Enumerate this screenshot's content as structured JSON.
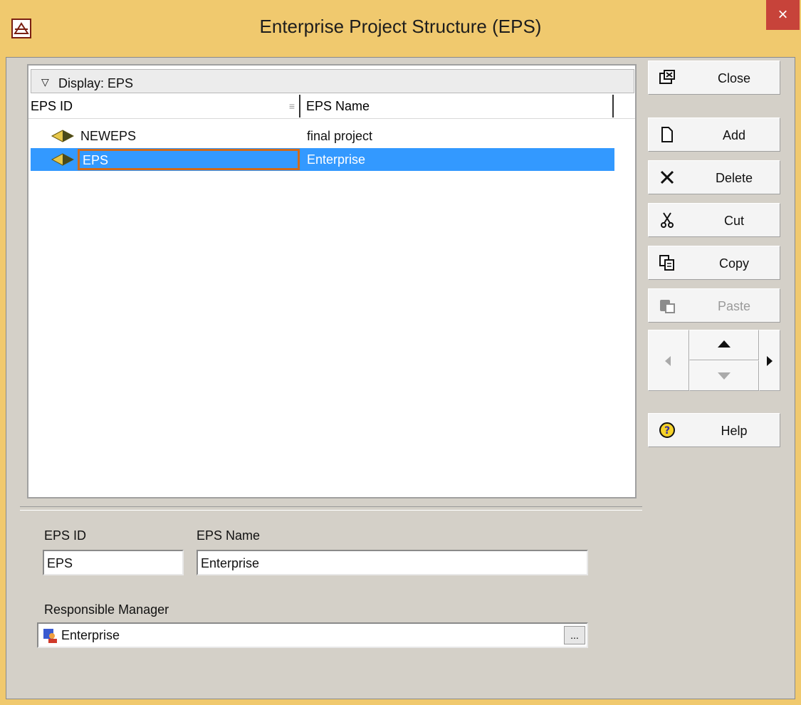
{
  "window": {
    "title": "Enterprise Project Structure (EPS)",
    "close_glyph": "×",
    "app_icon": "p6-logo-icon"
  },
  "grid": {
    "display_label": "Display: EPS",
    "columns": [
      "EPS ID",
      "EPS Name"
    ],
    "rows": [
      {
        "id": "NEWEPS",
        "name": "final project",
        "selected": false,
        "icon": "eps-node-icon"
      },
      {
        "id": "EPS",
        "name": "Enterprise",
        "selected": true,
        "icon": "eps-node-icon"
      }
    ]
  },
  "details": {
    "eps_id_label": "EPS ID",
    "eps_id_value": "EPS",
    "eps_name_label": "EPS Name",
    "eps_name_value": "Enterprise",
    "manager_label": "Responsible Manager",
    "manager_value": "Enterprise",
    "browse_label": "..."
  },
  "buttons": {
    "close": "Close",
    "add": "Add",
    "delete": "Delete",
    "cut": "Cut",
    "copy": "Copy",
    "paste": "Paste",
    "help": "Help"
  },
  "colors": {
    "title_bar": "#f0c96e",
    "selection": "#3399ff",
    "focus_border": "#d06a1a",
    "close_button": "#c7433a"
  }
}
